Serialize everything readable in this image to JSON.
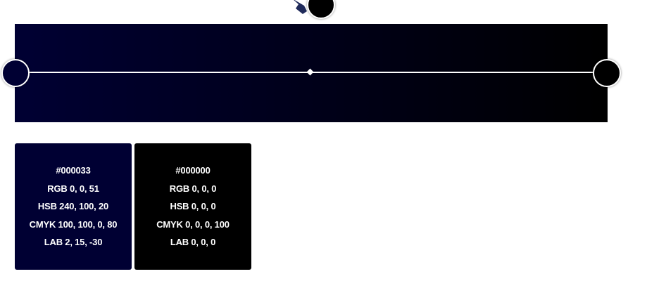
{
  "gradient": {
    "start_color": "#000033",
    "end_color": "#000000",
    "line_color": "#ffffff",
    "picker_shape_color": "#1f2a5a"
  },
  "swatches": [
    {
      "hex": "#000033",
      "rgb": "RGB 0, 0, 51",
      "hsb": "HSB 240, 100, 20",
      "cmyk": "CMYK 100, 100, 0, 80",
      "lab": "LAB 2, 15, -30",
      "background": "#000033"
    },
    {
      "hex": "#000000",
      "rgb": "RGB 0, 0, 0",
      "hsb": "HSB 0, 0, 0",
      "cmyk": "CMYK 0, 0, 0, 100",
      "lab": "LAB 0, 0, 0",
      "background": "#000000"
    }
  ]
}
